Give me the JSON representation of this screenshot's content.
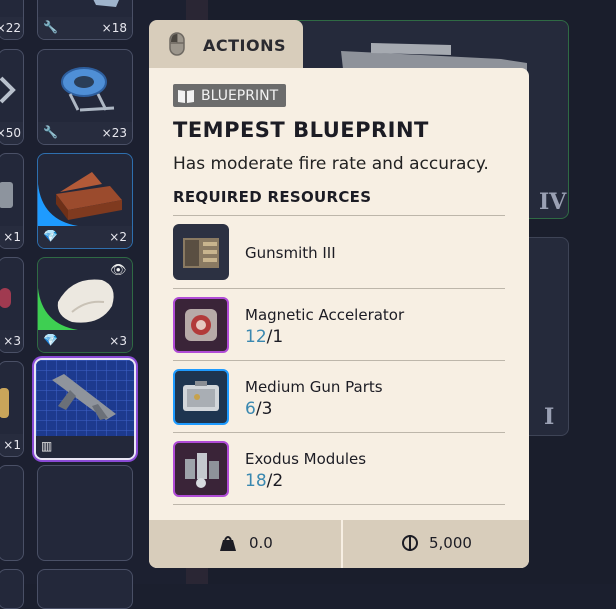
{
  "inventory": {
    "slots": [
      {
        "qty": "×22",
        "footer_icon": "wrench-icon"
      },
      {
        "qty": "×18",
        "footer_icon": "wrench-icon"
      },
      {
        "qty": "×50",
        "footer_icon": "wrench-icon"
      },
      {
        "qty": "×23",
        "footer_icon": "wrench-icon"
      },
      {
        "qty": "×1",
        "footer_icon": "diamond-icon"
      },
      {
        "qty": "×2",
        "footer_icon": "diamond-icon"
      },
      {
        "qty": "×3",
        "footer_icon": "diamond-icon"
      },
      {
        "qty": "×3",
        "footer_icon": "diamond-icon"
      },
      {
        "qty": "×1",
        "footer_icon": "book-icon"
      },
      {
        "qty": "",
        "footer_icon": "book-icon"
      }
    ]
  },
  "preview": {
    "tier_top": "IV",
    "tier_bottom": "I"
  },
  "actions_tab": {
    "label": "ACTIONS"
  },
  "tooltip": {
    "tag": "BLUEPRINT",
    "title": "TEMPEST BLUEPRINT",
    "description": "Has moderate fire rate and accuracy.",
    "required_header": "REQUIRED RESOURCES",
    "resources": [
      {
        "name": "Gunsmith III",
        "have": "",
        "sep": "",
        "need": ""
      },
      {
        "name": "Magnetic Accelerator",
        "have": "12",
        "sep": "/",
        "need": "1"
      },
      {
        "name": "Medium Gun Parts",
        "have": "6",
        "sep": "/",
        "need": "3"
      },
      {
        "name": "Exodus Modules",
        "have": "18",
        "sep": "/",
        "need": "2"
      }
    ],
    "weight": "0.0",
    "price": "5,000"
  },
  "colors": {
    "tooltip_bg": "#f7efe3",
    "accent_count": "#3a88b0",
    "rarity_blue": "#1e9bff",
    "rarity_green": "#3ecf52",
    "rarity_purple": "#b04bd6"
  }
}
